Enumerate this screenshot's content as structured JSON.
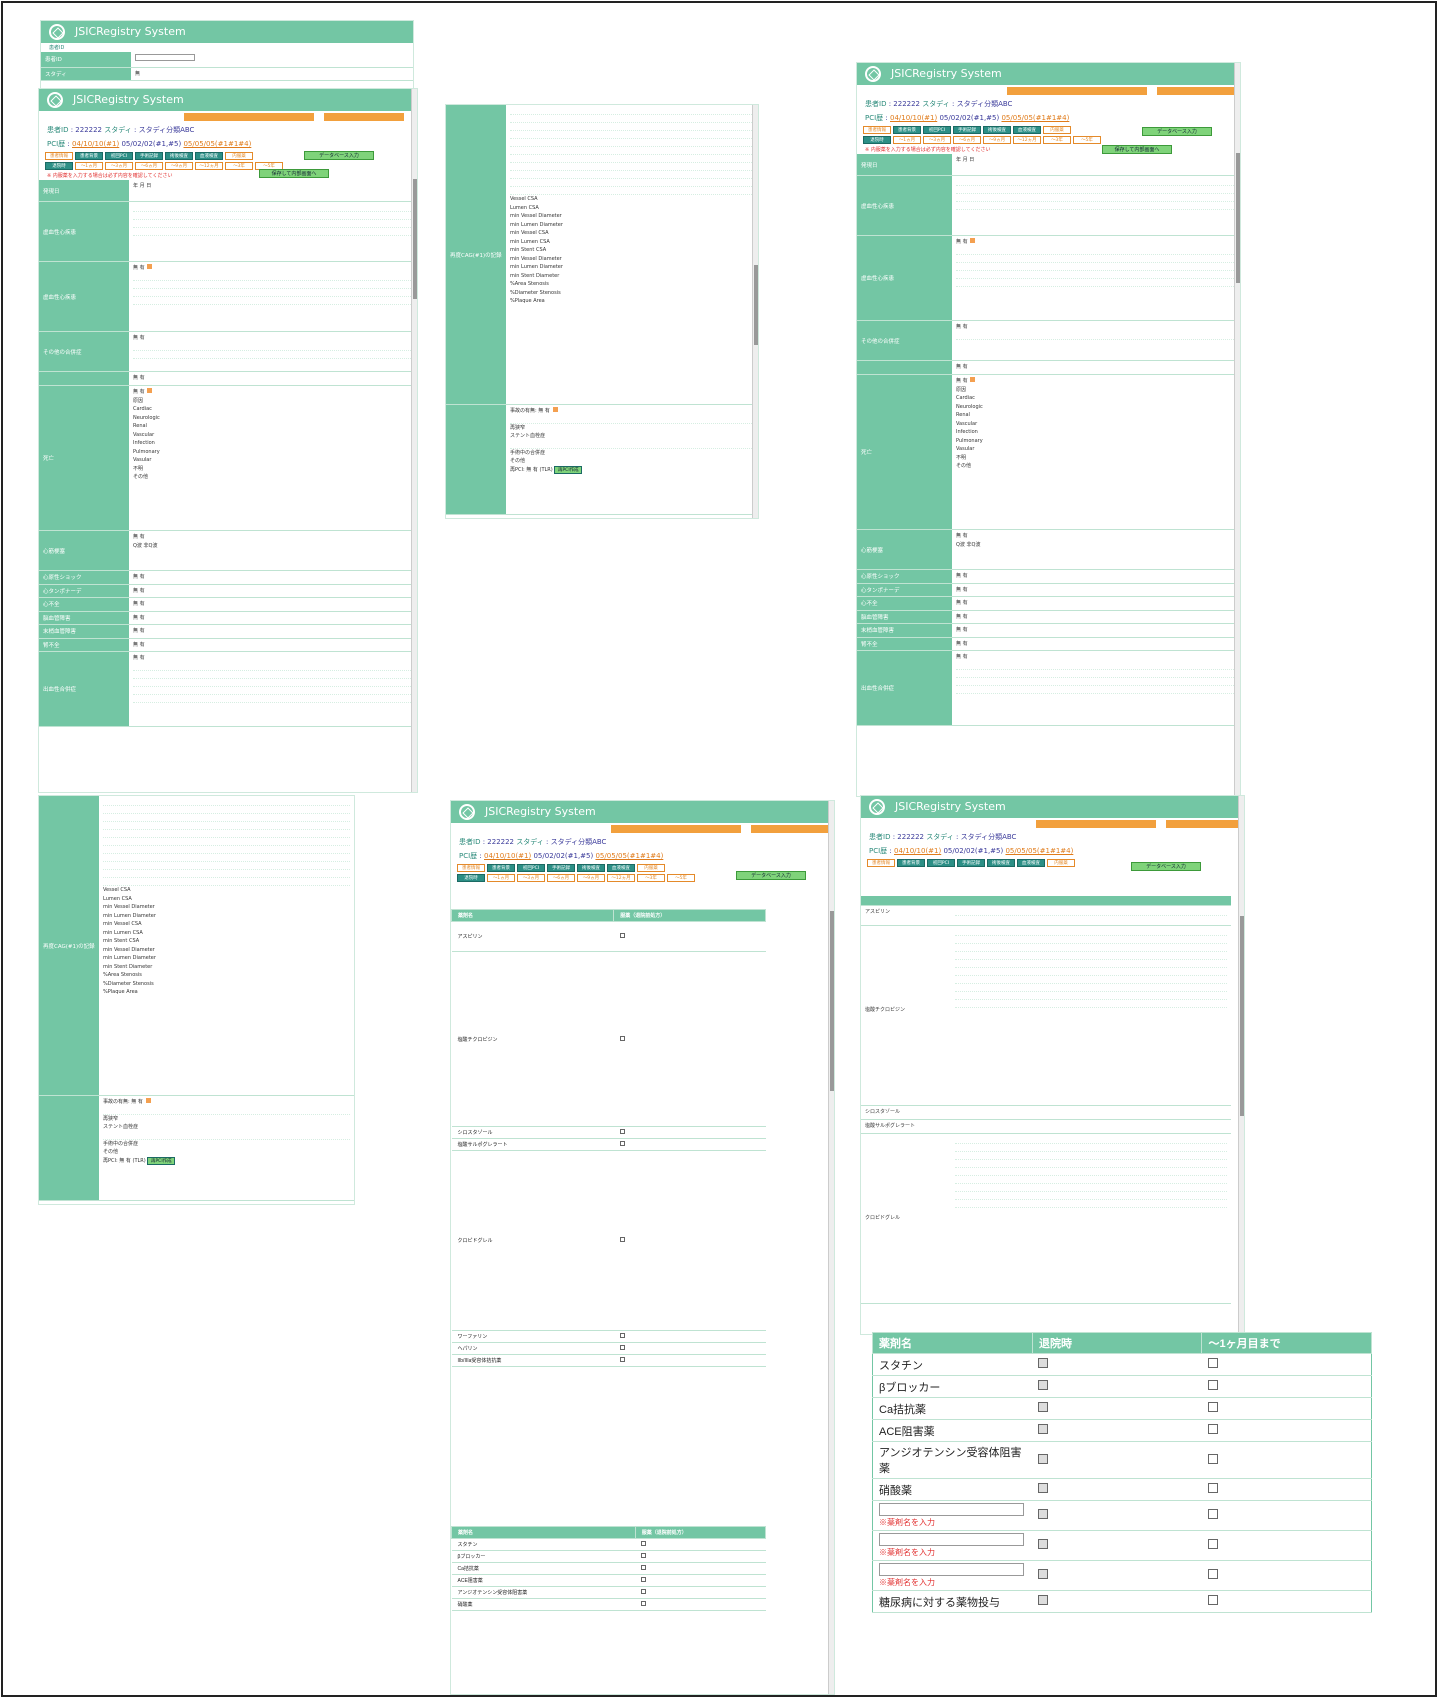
{
  "app_title": "JSICRegistry System",
  "patient": {
    "id_label": "患者ID",
    "id": "222222",
    "study_label": "スタディ",
    "study_value": "スタディ分類ABC",
    "pci_label": "PCI歴",
    "pci_link": "04/10/10(#1)",
    "pci_value": "05/02/02(#1,#5)",
    "pci_link2": "05/05/05(#1#1#4)"
  },
  "nav_tabs": [
    "患者情報",
    "患者背景",
    "初回PCI",
    "手術記録",
    "術後検査",
    "血液検査",
    "内服薬"
  ],
  "period_tabs": [
    "退院時",
    "〜1ヵ月",
    "〜3ヵ月",
    "〜6ヵ月",
    "〜9ヵ月",
    "〜12ヵ月",
    "〜3年",
    "〜5年"
  ],
  "data_entry_button": "データベース入力",
  "save_button": "保存して内部画面へ",
  "input_legend": "入力",
  "unentered_legend": "未入力",
  "red_note": "※ 内服薬を入力する場合は必ず内容を確認してください",
  "sections": {
    "death": "死亡",
    "mi": "心筋梗塞",
    "shock": "心原性ショック",
    "tamponade": "心タンポナーデ",
    "heart_failure": "心不全",
    "cerebral": "脳血管障害",
    "peripheral": "末梢血管障害",
    "renal": "腎不全",
    "bleeding": "出血性合併症",
    "ischemia": "虚血性心疾患",
    "other_complication": "その他の合併症",
    "cag": "再度CAG(#1)の記録",
    "event": "事故の有無"
  },
  "death_causes": [
    "Cardiac",
    "Neurologic",
    "Renal",
    "Vascular",
    "Infection",
    "Pulmonary",
    "Vasular",
    "不明",
    "その他"
  ],
  "ivus_fields": [
    "Vessel CSA",
    "Lumen CSA",
    "min Vessel Diameter",
    "min Lumen Diameter",
    "min Vessel CSA",
    "min Lumen CSA",
    "min Stent CSA",
    "min Vessel Diameter",
    "min Lumen Diameter",
    "min Stent Diameter",
    "%Area Stenosis",
    "%Diameter Stenosis",
    "%Plaque Area"
  ],
  "drug_table_headers": [
    "薬剤名",
    "服薬（退院前処方）"
  ],
  "drugs_small": [
    "アスピリン",
    "塩酸チクロピジン",
    "シロスタゾール",
    "塩酸サルポグレラート",
    "クロピドグレル",
    "ワーファリン",
    "ヘパリン",
    "IIb/IIIa受容体拮抗薬"
  ],
  "other_label": "その他",
  "drug_name_prompt": "※薬剤名を入力",
  "big_table": {
    "headers": [
      "薬剤名",
      "退院時",
      "〜1ヶ月目まで"
    ],
    "rows": [
      {
        "name": "スタチン"
      },
      {
        "name": "βブロッカー"
      },
      {
        "name": "Ca拮抗薬"
      },
      {
        "name": "ACE阻害薬"
      },
      {
        "name": "アンジオテンシン受容体阻害薬"
      },
      {
        "name": "硝酸薬"
      },
      {
        "name": "",
        "prompt": "※薬剤名を入力"
      },
      {
        "name": "",
        "prompt": "※薬剤名を入力"
      },
      {
        "name": "",
        "prompt": "※薬剤名を入力"
      },
      {
        "name": "糖尿病に対する薬物投与"
      }
    ]
  },
  "labels": {
    "none": "無",
    "yes": "有",
    "unknown": "不明",
    "date": "発現日",
    "year": "年",
    "month": "月",
    "day": "日",
    "detail": "内容",
    "q_wave": "Q波",
    "non_q": "非Q波",
    "cause": "原因",
    "gi_bleed": "消化管出血",
    "re_pci": "再PCI",
    "re_pci_btn": "再PCI作成",
    "tlr": "TLR",
    "stent_thrombosis": "ステント血栓症",
    "rehospital": "再狭窄",
    "surgery": "手術中の合併症"
  }
}
